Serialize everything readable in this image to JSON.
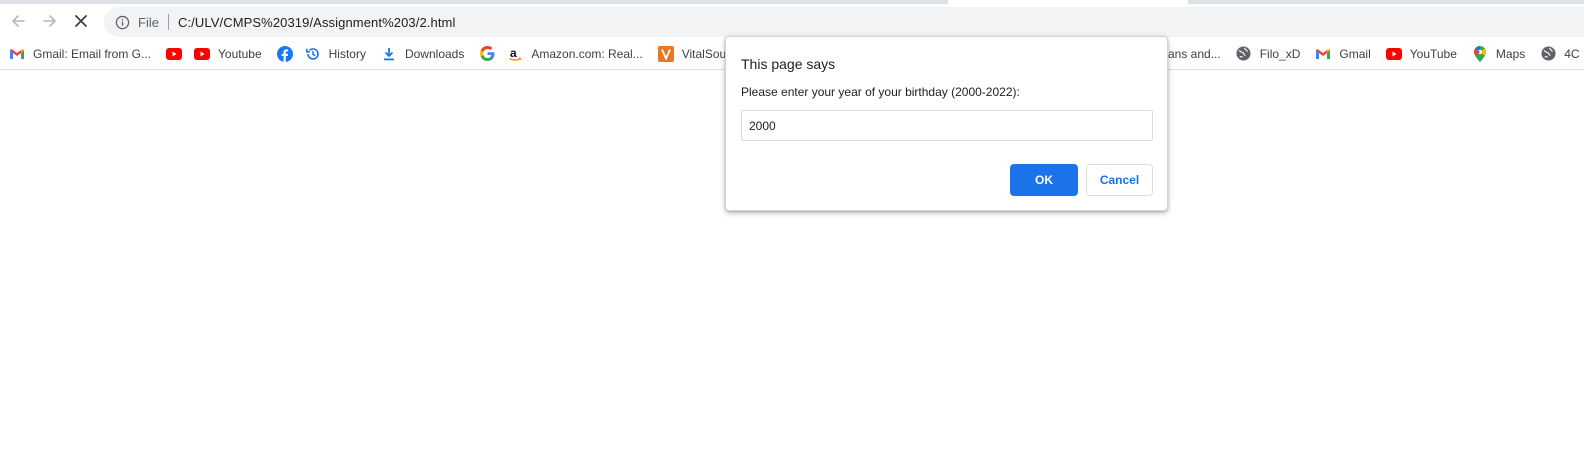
{
  "browser": {
    "back_icon": "arrow-left-icon",
    "forward_icon": "arrow-right-icon",
    "stop_icon": "close-x-icon",
    "address_bar": {
      "security_icon": "info-icon",
      "scheme_label": "File",
      "url": "C:/ULV/CMPS%20319/Assignment%203/2.html"
    }
  },
  "bookmarks": [
    {
      "label": "Gmail: Email from G...",
      "icon": "gmail-icon"
    },
    {
      "label": "",
      "icon": "youtube-icon"
    },
    {
      "label": "Youtube",
      "icon": "youtube-icon"
    },
    {
      "label": "",
      "icon": "facebook-icon"
    },
    {
      "label": "History",
      "icon": "history-icon"
    },
    {
      "label": "Downloads",
      "icon": "download-icon"
    },
    {
      "label": "",
      "icon": "google-icon"
    },
    {
      "label": "Amazon.com: Real...",
      "icon": "amazon-icon"
    },
    {
      "label": "VitalSou",
      "icon": "vitalsource-icon"
    },
    {
      "label": "ans and...",
      "icon": ""
    },
    {
      "label": "Filo_xD",
      "icon": "globe-icon"
    },
    {
      "label": "Gmail",
      "icon": "gmail-icon"
    },
    {
      "label": "YouTube",
      "icon": "youtube-icon"
    },
    {
      "label": "Maps",
      "icon": "maps-icon"
    },
    {
      "label": "4C",
      "icon": "globe-icon"
    }
  ],
  "dialog": {
    "title": "This page says",
    "message": "Please enter your year of your birthday (2000-2022):",
    "input_value": "2000",
    "ok_label": "OK",
    "cancel_label": "Cancel"
  },
  "colors": {
    "accent": "#1a73e8",
    "youtube_red": "#ff0000",
    "facebook_blue": "#1877f2",
    "vitalsource_orange": "#e87722"
  }
}
